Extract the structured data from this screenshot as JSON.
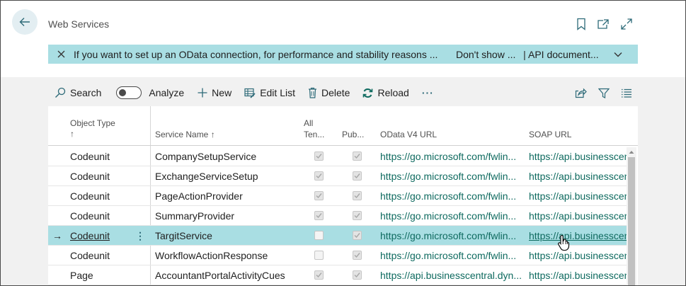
{
  "header": {
    "title": "Web Services",
    "icons": [
      "back-arrow-icon",
      "bookmark-icon",
      "open-new-window-icon",
      "expand-icon"
    ]
  },
  "banner": {
    "message": "If you want to set up an OData connection, for performance and stability reasons ...",
    "link1": "Don't show ...",
    "separator": "|",
    "link2": "API document..."
  },
  "toolbar": {
    "search": "Search",
    "analyze": "Analyze",
    "new": "New",
    "edit_list": "Edit List",
    "delete": "Delete",
    "reload": "Reload",
    "more": "···"
  },
  "columns": {
    "object_type": "Object Type",
    "object_type_sort": "↑",
    "service_name": "Service Name ↑",
    "all_tenants_1": "All",
    "all_tenants_2": "Ten...",
    "published": "Pub...",
    "odata_url": "OData V4 URL",
    "soap_url": "SOAP URL"
  },
  "rows": [
    {
      "object_type": "Codeunit",
      "service_name": "CompanySetupService",
      "all_tenants": true,
      "published": true,
      "odata_url": "https://go.microsoft.com/fwlin...",
      "soap_url": "https://api.businesscen"
    },
    {
      "object_type": "Codeunit",
      "service_name": "ExchangeServiceSetup",
      "all_tenants": true,
      "published": true,
      "odata_url": "https://go.microsoft.com/fwlin...",
      "soap_url": "https://api.businesscen"
    },
    {
      "object_type": "Codeunit",
      "service_name": "PageActionProvider",
      "all_tenants": true,
      "published": true,
      "odata_url": "https://go.microsoft.com/fwlin...",
      "soap_url": "https://api.businesscen"
    },
    {
      "object_type": "Codeunit",
      "service_name": "SummaryProvider",
      "all_tenants": true,
      "published": true,
      "odata_url": "https://go.microsoft.com/fwlin...",
      "soap_url": "https://api.businesscen"
    },
    {
      "object_type": "Codeunit",
      "service_name": "TargitService",
      "all_tenants": false,
      "published": true,
      "odata_url": "https://go.microsoft.com/fwlin...",
      "soap_url": "https://api.businesscen",
      "selected": true
    },
    {
      "object_type": "Codeunit",
      "service_name": "WorkflowActionResponse",
      "all_tenants": false,
      "published": true,
      "odata_url": "https://go.microsoft.com/fwlin...",
      "soap_url": "https://api.businesscen"
    },
    {
      "object_type": "Page",
      "service_name": "AccountantPortalActivityCues",
      "all_tenants": true,
      "published": true,
      "odata_url": "https://api.businesscentral.dyn...",
      "soap_url": "https://api.businesscen"
    }
  ],
  "row_marker": "→",
  "row_menu": "⋮",
  "colors": {
    "accent": "#a9dee3",
    "link": "#0e6a5f",
    "content_bg": "#f1f1f1"
  }
}
